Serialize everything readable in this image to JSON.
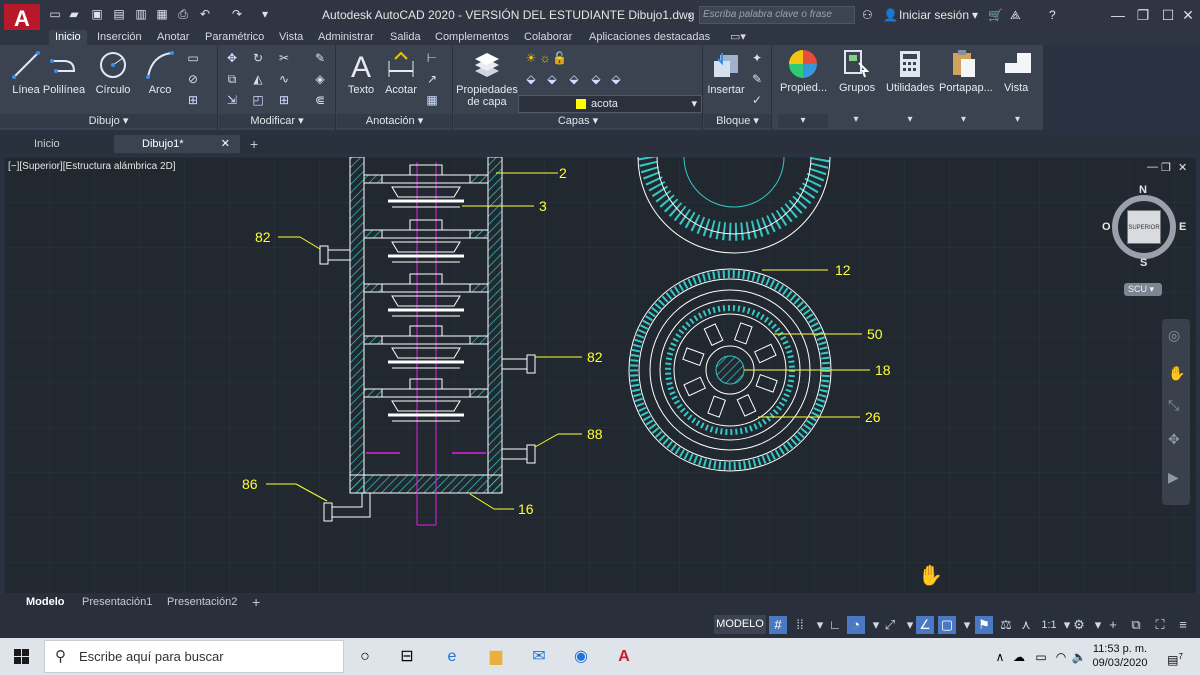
{
  "titlebar": {
    "logo": "A",
    "title": "Autodesk AutoCAD 2020 - VERSIÓN DEL ESTUDIANTE    Dibujo1.dwg",
    "search_placeholder": "Escriba palabra clave o frase",
    "signin": "Iniciar sesión"
  },
  "ribbon_tabs": [
    "Inicio",
    "Inserción",
    "Anotar",
    "Paramétrico",
    "Vista",
    "Administrar",
    "Salida",
    "Complementos",
    "Colaborar",
    "Aplicaciones destacadas"
  ],
  "ribbon": {
    "dibujo": {
      "title": "Dibujo",
      "tools": [
        "Línea",
        "Polilínea",
        "Círculo",
        "Arco"
      ]
    },
    "modificar": {
      "title": "Modificar"
    },
    "anotacion": {
      "title": "Anotación",
      "tools": [
        "Texto",
        "Acotar"
      ]
    },
    "capas": {
      "title": "Capas",
      "properties_line1": "Propiedades",
      "properties_line2": "de capa",
      "layer_name": "acota"
    },
    "bloque": {
      "title": "Bloque",
      "insert": "Insertar"
    },
    "extra": [
      "Propied...",
      "Grupos",
      "Utilidades",
      "Portapap...",
      "Vista"
    ]
  },
  "file_tabs": {
    "home": "Inicio",
    "drawing": "Dibujo1*"
  },
  "viewport": {
    "label": "[−][Superior][Estructura alámbrica 2D]",
    "viewcube": {
      "n": "N",
      "s": "S",
      "e": "E",
      "o": "O",
      "face": "SUPERIOR",
      "ucs": "SCU"
    }
  },
  "callouts": [
    "2",
    "3",
    "82",
    "82",
    "88",
    "86",
    "16",
    "12",
    "50",
    "18",
    "26"
  ],
  "layout_tabs": [
    "Modelo",
    "Presentación1",
    "Presentación2"
  ],
  "statusbar": {
    "model": "MODELO",
    "scale": "1:1"
  },
  "taskbar": {
    "search_placeholder": "Escribe aquí para buscar",
    "time": "11:53 p. m.",
    "date": "09/03/2020",
    "notifications": "7"
  },
  "colors": {
    "accent": "#b8192a",
    "hatch": "#35c7c3",
    "callout": "#ffff33",
    "magenta": "#e020e0"
  }
}
